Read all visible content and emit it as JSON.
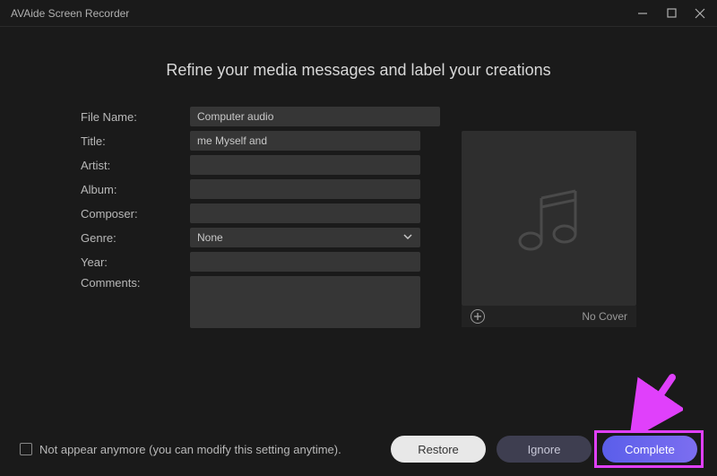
{
  "app": {
    "title": "AVAide Screen Recorder"
  },
  "heading": "Refine your media messages and label your creations",
  "form": {
    "fileName": {
      "label": "File Name:",
      "value": "Computer audio"
    },
    "title": {
      "label": "Title:",
      "value": "me Myself and "
    },
    "artist": {
      "label": "Artist:",
      "value": ""
    },
    "album": {
      "label": "Album:",
      "value": ""
    },
    "composer": {
      "label": "Composer:",
      "value": ""
    },
    "genre": {
      "label": "Genre:",
      "value": "None"
    },
    "year": {
      "label": "Year:",
      "value": ""
    },
    "comments": {
      "label": "Comments:",
      "value": ""
    }
  },
  "cover": {
    "noCoverLabel": "No Cover"
  },
  "checkbox": {
    "label": "Not appear anymore (you can modify this setting anytime)."
  },
  "buttons": {
    "restore": "Restore",
    "ignore": "Ignore",
    "complete": "Complete"
  }
}
